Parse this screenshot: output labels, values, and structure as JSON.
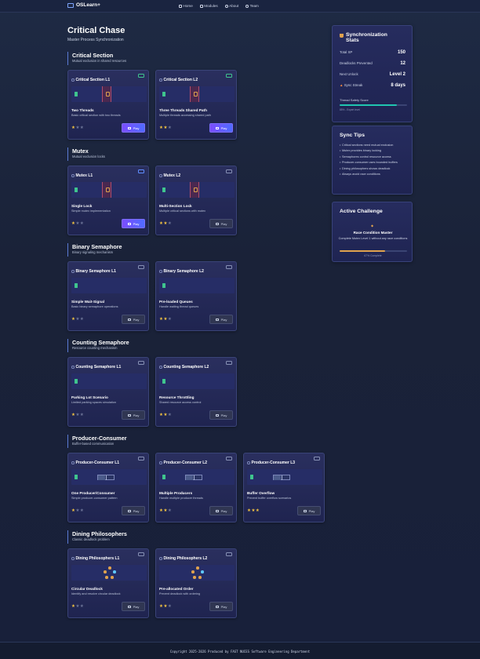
{
  "nav": {
    "brand": "OSLearn+",
    "links": [
      {
        "label": "Home",
        "icon": "home-icon"
      },
      {
        "label": "Modules",
        "icon": "book-icon"
      },
      {
        "label": "About",
        "icon": "info-icon"
      },
      {
        "label": "Team",
        "icon": "users-icon"
      }
    ]
  },
  "header": {
    "title": "Critical Chase",
    "subtitle": "Master Process Synchronization"
  },
  "sections": [
    {
      "title": "Critical Section",
      "subtitle": "Mutual exclusion in shared resources",
      "cards": [
        {
          "title": "Critical Section L1",
          "name": "Two Threads",
          "desc": "Basic critical section with two threads",
          "stars": "1/3",
          "locked": false,
          "badge": "open",
          "play": "Play",
          "viz": "lock"
        },
        {
          "title": "Critical Section L2",
          "name": "Three Threads Shared Path",
          "desc": "Multiple threads accessing shared path",
          "stars": "2/3",
          "locked": false,
          "badge": "open",
          "play": "Play",
          "viz": "lock"
        }
      ]
    },
    {
      "title": "Mutex",
      "subtitle": "Mutual exclusion locks",
      "cards": [
        {
          "title": "Mutex L1",
          "name": "Single Lock",
          "desc": "Simple mutex implementation",
          "stars": "1/3",
          "locked": false,
          "badge": "blue",
          "play": "Play",
          "viz": "lock"
        },
        {
          "title": "Mutex L2",
          "name": "Multi-Section Lock",
          "desc": "Multiple critical sections with mutex",
          "stars": "2/3",
          "locked": true,
          "badge": "lock",
          "play": "Play",
          "viz": "lock"
        }
      ]
    },
    {
      "title": "Binary Semaphore",
      "subtitle": "Binary signaling mechanism",
      "cards": [
        {
          "title": "Binary Semaphore L1",
          "name": "Simple Wait-Signal",
          "desc": "Basic binary semaphore operations",
          "stars": "1/3",
          "locked": true,
          "badge": "lock",
          "play": "Play",
          "viz": "plain"
        },
        {
          "title": "Binary Semaphore L2",
          "name": "Pre-loaded Queues",
          "desc": "Handle waiting thread queues",
          "stars": "2/3",
          "locked": true,
          "badge": "lock",
          "play": "Play",
          "viz": "plain"
        }
      ]
    },
    {
      "title": "Counting Semaphore",
      "subtitle": "Resource counting mechanism",
      "cards": [
        {
          "title": "Counting Semaphore L1",
          "name": "Parking Lot Scenario",
          "desc": "Limited parking spaces simulation",
          "stars": "1/3",
          "locked": true,
          "badge": "lock",
          "play": "Play",
          "viz": "plain"
        },
        {
          "title": "Counting Semaphore L2",
          "name": "Resource Throttling",
          "desc": "Shared resource access control",
          "stars": "2/3",
          "locked": true,
          "badge": "lock",
          "play": "Play",
          "viz": "plain"
        }
      ]
    },
    {
      "title": "Producer-Consumer",
      "subtitle": "Buffer-based communication",
      "cards": [
        {
          "title": "Producer-Consumer L1",
          "name": "One Producer/Consumer",
          "desc": "Simple producer-consumer pattern",
          "stars": "1/3",
          "locked": true,
          "badge": "lock",
          "play": "Play",
          "viz": "buffer"
        },
        {
          "title": "Producer-Consumer L2",
          "name": "Multiple Producers",
          "desc": "Handle multiple producer threads",
          "stars": "2/3",
          "locked": true,
          "badge": "lock",
          "play": "Play",
          "viz": "buffer"
        },
        {
          "title": "Producer-Consumer L3",
          "name": "Buffer Overflow",
          "desc": "Prevent buffer overflow scenarios",
          "stars": "3/3",
          "locked": true,
          "badge": "lock",
          "play": "Play",
          "viz": "buffer"
        }
      ]
    },
    {
      "title": "Dining Philosophers",
      "subtitle": "Classic deadlock problem",
      "cards": [
        {
          "title": "Dining Philosophers L1",
          "name": "Circular Deadlock",
          "desc": "Identify and resolve circular deadlock",
          "stars": "1/3",
          "locked": true,
          "badge": "lock",
          "play": "Play",
          "viz": "phil"
        },
        {
          "title": "Dining Philosophers L2",
          "name": "Pre-allocated Order",
          "desc": "Prevent deadlock with ordering",
          "stars": "2/3",
          "locked": true,
          "badge": "lock",
          "play": "Play",
          "viz": "phil"
        }
      ]
    }
  ],
  "stats": {
    "title_line1": "Synchronization",
    "title_line2": "Stats",
    "rows": [
      {
        "label": "Total XP",
        "value": "150"
      },
      {
        "label": "Deadlocks Prevented",
        "value": "12"
      },
      {
        "label": "Next Unlock",
        "value": "Level 2"
      },
      {
        "label": "Sync Streak",
        "value": "8 days",
        "icon": "fire-icon"
      }
    ],
    "safety_label": "Thread Safety Score",
    "safety_fraction": 0.85,
    "safety_caption": "85% - Expert level",
    "colors": {
      "safety": "#20c5b0",
      "challenge": "#e0a24e"
    }
  },
  "tips": {
    "title": "Sync Tips",
    "items": [
      "Critical sections need mutual exclusion",
      "Mutex provides binary locking",
      "Semaphores control resource access",
      "Producer-consumer uses bounded buffers",
      "Dining philosophers shows deadlock",
      "Always avoid race conditions"
    ]
  },
  "challenge": {
    "title": "Active Challenge",
    "name": "Race Condition Master",
    "desc": "Complete Mutex Level 1 without any race conditions",
    "progress_fraction": 0.67,
    "caption": "67% Complete"
  },
  "footer": {
    "text": "Copyright 2025-2026 Produced by FAST NUCES Software Engineering Department"
  }
}
